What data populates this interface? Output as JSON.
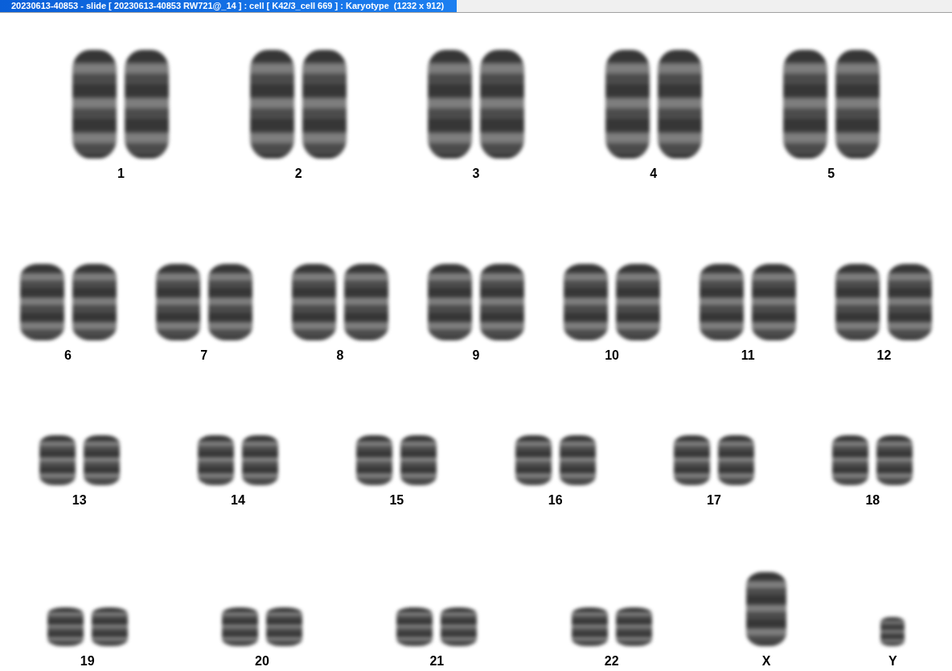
{
  "window": {
    "title": "20230613-40853 - slide [ 20230613-40853 RW721@_14 ] : cell [ K42/3_cell 669 ] : Karyotype  (1232 x 912)"
  },
  "rows": [
    [
      {
        "label": "1",
        "kind": "pair"
      },
      {
        "label": "2",
        "kind": "pair"
      },
      {
        "label": "3",
        "kind": "pair"
      },
      {
        "label": "4",
        "kind": "pair"
      },
      {
        "label": "5",
        "kind": "pair"
      }
    ],
    [
      {
        "label": "6",
        "kind": "pair"
      },
      {
        "label": "7",
        "kind": "pair"
      },
      {
        "label": "8",
        "kind": "pair"
      },
      {
        "label": "9",
        "kind": "pair"
      },
      {
        "label": "10",
        "kind": "pair"
      },
      {
        "label": "11",
        "kind": "pair"
      },
      {
        "label": "12",
        "kind": "pair"
      }
    ],
    [
      {
        "label": "13",
        "kind": "pair"
      },
      {
        "label": "14",
        "kind": "pair"
      },
      {
        "label": "15",
        "kind": "pair"
      },
      {
        "label": "16",
        "kind": "pair"
      },
      {
        "label": "17",
        "kind": "pair"
      },
      {
        "label": "18",
        "kind": "pair"
      }
    ],
    [
      {
        "label": "19",
        "kind": "pair"
      },
      {
        "label": "20",
        "kind": "pair"
      },
      {
        "label": "21",
        "kind": "pair"
      },
      {
        "label": "22",
        "kind": "pair"
      },
      {
        "label": "X",
        "kind": "tall"
      },
      {
        "label": "Y",
        "kind": "short"
      }
    ]
  ]
}
